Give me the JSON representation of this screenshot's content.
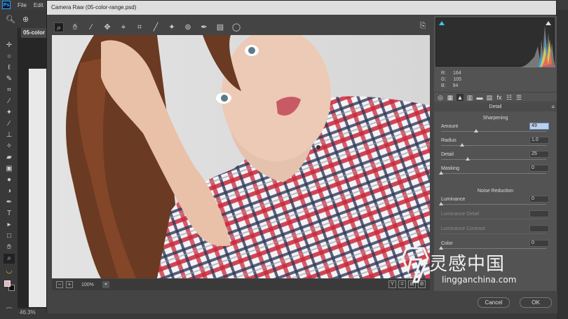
{
  "ps": {
    "logo": "Ps",
    "menus": [
      "File",
      "Edit"
    ],
    "doc_tab": "05-color",
    "zoom_status": "46.3%",
    "toolbar_icons": [
      "move-icon",
      "marquee-icon",
      "lasso-icon",
      "quick-select-icon",
      "crop-icon",
      "eyedropper-icon",
      "healing-icon",
      "brush-icon",
      "clone-stamp-icon",
      "history-brush-icon",
      "eraser-icon",
      "gradient-icon",
      "blur-icon",
      "dodge-icon",
      "pen-icon",
      "type-icon",
      "path-select-icon",
      "rectangle-icon",
      "hand-icon",
      "zoom-icon",
      "banana-icon",
      "foreground-background-colors",
      "quick-mask-icon"
    ]
  },
  "camera_raw": {
    "title": "Camera Raw (05-color-range.psd)",
    "toolbar_icons": [
      "zoom-icon",
      "hand-icon",
      "white-balance-icon",
      "color-sampler-icon",
      "targeted-adjust-icon",
      "crop-icon",
      "straighten-icon",
      "spot-removal-icon",
      "red-eye-icon",
      "adjustment-brush-icon",
      "graduated-filter-icon",
      "radial-filter-icon"
    ],
    "open_preferences_icon": "open-in-panel-icon",
    "footer": {
      "zoom": "100%",
      "view_buttons": [
        "Y",
        "≑",
        "⊞",
        "⚙"
      ]
    },
    "buttons": {
      "cancel": "Cancel",
      "ok": "OK"
    },
    "readout": {
      "r_label": "R:",
      "r": "164",
      "g_label": "G:",
      "g": "105",
      "b_label": "B:",
      "b": "94"
    },
    "panel_title": "Detail",
    "sharpening": {
      "heading": "Sharpening",
      "sliders": [
        {
          "label": "Amount",
          "value": "49",
          "position": 0.33,
          "active": true
        },
        {
          "label": "Radius",
          "value": "1.0",
          "position": 0.2,
          "active": false
        },
        {
          "label": "Detail",
          "value": "25",
          "position": 0.25,
          "active": false
        },
        {
          "label": "Masking",
          "value": "0",
          "position": 0.0,
          "active": false
        }
      ]
    },
    "noise_reduction": {
      "heading": "Noise Reduction",
      "sliders": [
        {
          "label": "Luminance",
          "value": "0",
          "position": 0.0,
          "dim": false
        },
        {
          "label": "Luminance Detail",
          "value": "",
          "position": 0.0,
          "dim": true
        },
        {
          "label": "Luminance Contrast",
          "value": "",
          "position": 0.0,
          "dim": true
        },
        {
          "label": "Color",
          "value": "0",
          "position": 0.0,
          "dim": false
        }
      ]
    }
  },
  "watermark": {
    "title": "灵感中国",
    "url": "lingganchina.com"
  }
}
